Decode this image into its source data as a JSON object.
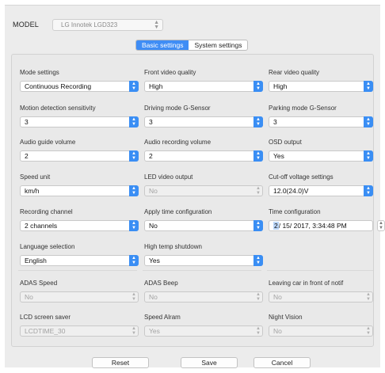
{
  "model": {
    "label": "MODEL",
    "value": "LG Innotek LGD323"
  },
  "tabs": [
    {
      "label": "Basic settings",
      "active": true
    },
    {
      "label": "System settings",
      "active": false
    }
  ],
  "fields": [
    {
      "id": "mode",
      "label": "Mode settings",
      "value": "Continuous Recording",
      "disabled": false
    },
    {
      "id": "front-quality",
      "label": "Front video quality",
      "value": "High",
      "disabled": false
    },
    {
      "id": "rear-quality",
      "label": "Rear video quality",
      "value": "High",
      "disabled": false
    },
    {
      "id": "motion",
      "label": "Motion detection sensitivity",
      "value": "3",
      "disabled": false
    },
    {
      "id": "driving-gsensor",
      "label": "Driving mode G-Sensor",
      "value": "3",
      "disabled": false
    },
    {
      "id": "parking-gsensor",
      "label": "Parking mode G-Sensor",
      "value": "3",
      "disabled": false
    },
    {
      "id": "audio-guide",
      "label": "Audio guide volume",
      "value": "2",
      "disabled": false
    },
    {
      "id": "audio-rec",
      "label": "Audio recording volume",
      "value": "2",
      "disabled": false
    },
    {
      "id": "osd",
      "label": "OSD output",
      "value": "Yes",
      "disabled": false
    },
    {
      "id": "speed-unit",
      "label": "Speed unit",
      "value": "km/h",
      "disabled": false
    },
    {
      "id": "led",
      "label": "LED video output",
      "value": "No",
      "disabled": true
    },
    {
      "id": "cutoff",
      "label": "Cut-off voltage settings",
      "value": "12.0(24.0)V",
      "disabled": false
    },
    {
      "id": "rec-channel",
      "label": "Recording channel",
      "value": "2 channels",
      "disabled": false
    },
    {
      "id": "apply-time",
      "label": "Apply time configuration",
      "value": "No",
      "disabled": false
    },
    {
      "id": "time-config",
      "label": "Time configuration",
      "value_month": "2",
      "value_rest": "/ 15/ 2017,  3:34:48 PM",
      "disabled": false
    },
    {
      "id": "language",
      "label": "Language selection",
      "value": "English",
      "disabled": false
    },
    {
      "id": "high-temp",
      "label": "High temp shutdown",
      "value": "Yes",
      "disabled": false
    },
    {
      "id": "adas-speed",
      "label": "ADAS Speed",
      "value": "No",
      "disabled": true
    },
    {
      "id": "adas-beep",
      "label": "ADAS Beep",
      "value": "No",
      "disabled": true
    },
    {
      "id": "leaving-car",
      "label": "Leaving car in front of notif",
      "value": "No",
      "disabled": true
    },
    {
      "id": "lcd-saver",
      "label": "LCD screen saver",
      "value": "LCDTIME_30",
      "disabled": true
    },
    {
      "id": "speed-alarm",
      "label": "Speed Alram",
      "value": "Yes",
      "disabled": true
    },
    {
      "id": "night-vision",
      "label": "Night Vision",
      "value": "No",
      "disabled": true
    }
  ],
  "buttons": {
    "reset": "Reset",
    "save": "Save",
    "cancel": "Cancel"
  },
  "colors": {
    "accent": "#3a8ef4",
    "window_bg": "#ececec"
  }
}
